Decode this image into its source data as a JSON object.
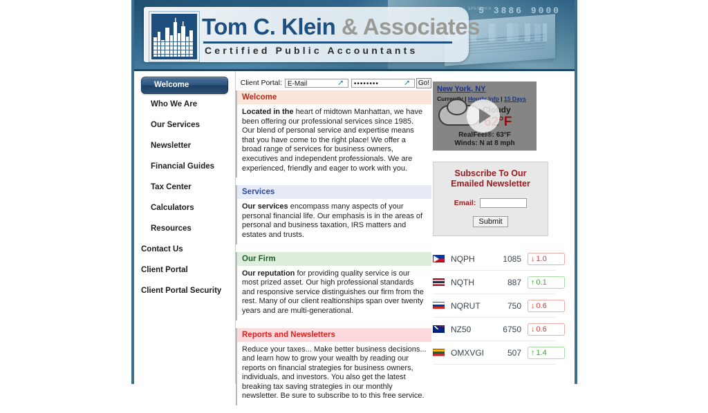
{
  "header": {
    "firm_name_primary": "Tom C. Klein",
    "firm_name_amp": "&",
    "firm_name_secondary": "Associates",
    "firm_subtitle": "Certified Public Accountants",
    "banner_number": "5 3886 9000",
    "banner_micro": "PRIN ALREADY   AL  SPECIMEN"
  },
  "sidebar": {
    "active_item": "Welcome",
    "items": [
      {
        "label": "Who We Are",
        "top": false
      },
      {
        "label": "Our Services",
        "top": false
      },
      {
        "label": "Newsletter",
        "top": false
      },
      {
        "label": "Financial Guides",
        "top": false
      },
      {
        "label": "Tax Center",
        "top": false
      },
      {
        "label": "Calculators",
        "top": false
      },
      {
        "label": "Resources",
        "top": false
      },
      {
        "label": "Contact Us",
        "top": true
      },
      {
        "label": "Client Portal",
        "top": true
      },
      {
        "label": "Client Portal Security",
        "top": true
      }
    ]
  },
  "client_portal": {
    "label": "Client Portal:",
    "email_value": "E-Mail",
    "email_placeholder": "E-Mail",
    "password_value": "••••••••",
    "go_label": "Go!"
  },
  "content": {
    "boxes": [
      {
        "title": "Welcome",
        "lead": "Located in the",
        "body": " heart of midtown Manhattan, we have been offering our professional services since 1985. Our blend of personal service and expertise means that you have come to the right place! We offer a broad range of services for business owners, executives and independent professionals. We are experienced, friendly and eager to work with you."
      },
      {
        "title": "Services",
        "lead": "Our services",
        "body": " encompass many aspects of your personal financial life. Our emphasis is in the areas of personal and business taxation, IRS matters and estates and trusts."
      },
      {
        "title": "Our Firm",
        "lead": "Our reputation",
        "body": " for providing quality service is our most prized asset. Our high professional standards and responsive service distinguishes our firm from the rest. Many of our client realtionships span over twenty years and are multi-generational."
      },
      {
        "title": "Reports and Newsletters",
        "lead": "",
        "body": "Reduce your taxes... Make better business decisions... and learn how to grow your wealth by reading our reports on financial strategies for business owners, individuals, and investors. You also get the latest breaking tax saving strategies in our monthly newsletter. Be sure to subscribe to to this free service."
      }
    ]
  },
  "weather": {
    "city": "New York, NY",
    "link_currently": "Currently",
    "link_hourly": "Hourly Info",
    "link_15days": "15 Days",
    "separator": " | ",
    "condition": "Cloudy",
    "temperature": "62°F",
    "realfeel": "RealFeel®: 63°F",
    "winds": "Winds: N at 8 mph"
  },
  "newsletter": {
    "title_line1": "Subscribe To Our",
    "title_line2": "Emailed Newsletter",
    "email_label": "Email:",
    "email_value": "",
    "submit_label": "Submit"
  },
  "ticker": {
    "rows": [
      {
        "flag": "f-ph",
        "flag_name": "philippines-flag",
        "symbol": "NQPH",
        "value": "1085",
        "arrow": "↓",
        "change": "1.0",
        "dir": "dn"
      },
      {
        "flag": "f-th",
        "flag_name": "thailand-flag",
        "symbol": "NQTH",
        "value": "887",
        "arrow": "↑",
        "change": "0.1",
        "dir": "up"
      },
      {
        "flag": "f-ru",
        "flag_name": "russia-flag",
        "symbol": "NQRUT",
        "value": "750",
        "arrow": "↓",
        "change": "0.6",
        "dir": "dn"
      },
      {
        "flag": "f-nz",
        "flag_name": "new-zealand-flag",
        "symbol": "NZ50",
        "value": "6750",
        "arrow": "↓",
        "change": "0.6",
        "dir": "dn"
      },
      {
        "flag": "f-lt",
        "flag_name": "lithuania-flag",
        "symbol": "OMXVGI",
        "value": "507",
        "arrow": "↑",
        "change": "1.4",
        "dir": "up"
      }
    ]
  },
  "colors": {
    "brand_blue": "#1c5083",
    "frame_blue": "#3d6e8c",
    "accent_red": "#b12a1c",
    "up_green": "#35a436",
    "down_red": "#e2342c"
  }
}
